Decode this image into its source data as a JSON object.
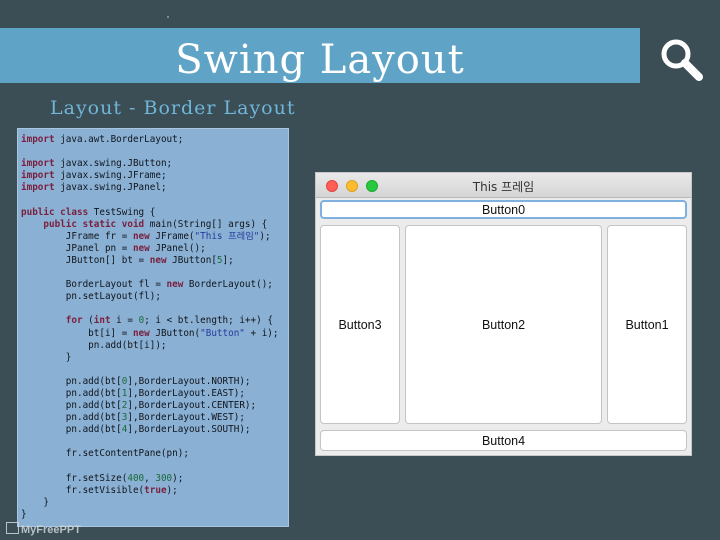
{
  "slide": {
    "title": "Swing Layout",
    "subtitle": "Layout - Border Layout",
    "watermark": "MyFreePPT",
    "colors": {
      "background": "#3b4d55",
      "title_bar": "#5fa3c6",
      "subtitle": "#6fb6d8",
      "code_panel": "#8ab0d4"
    }
  },
  "code": {
    "l01": "import",
    "l01b": " java.awt.BorderLayout;",
    "l03": "import",
    "l03b": " javax.swing.JButton;",
    "l04": "import",
    "l04b": " javax.swing.JFrame;",
    "l05": "import",
    "l05b": " javax.swing.JPanel;",
    "l07a": "public class",
    "l07b": " TestSwing {",
    "l08a": "public static void",
    "l08b": " main(String[] args) {",
    "l09a": "JFrame fr = ",
    "l09b": "new",
    "l09c": " JFrame(",
    "l09d": "\"This 프레임\"",
    "l09e": ");",
    "l10a": "JPanel pn = ",
    "l10b": "new",
    "l10c": " JPanel();",
    "l11a": "JButton[] bt = ",
    "l11b": "new",
    "l11c": " JButton[",
    "l11d": "5",
    "l11e": "];",
    "l13a": "BorderLayout fl = ",
    "l13b": "new",
    "l13c": " BorderLayout();",
    "l14": "pn.setLayout(fl);",
    "l16a": "for",
    "l16b": " (",
    "l16c": "int",
    "l16d": " i = ",
    "l16e": "0",
    "l16f": "; i < bt.length; i++) {",
    "l17a": "bt[i] = ",
    "l17b": "new",
    "l17c": " JButton(",
    "l17d": "\"Button\"",
    "l17e": " + i);",
    "l18": "pn.add(bt[i]);",
    "l19": "}",
    "l21a": "pn.add(bt[",
    "l21b": "0",
    "l21c": "],BorderLayout.NORTH);",
    "l22a": "pn.add(bt[",
    "l22b": "1",
    "l22c": "],BorderLayout.EAST);",
    "l23a": "pn.add(bt[",
    "l23b": "2",
    "l23c": "],BorderLayout.CENTER);",
    "l24a": "pn.add(bt[",
    "l24b": "3",
    "l24c": "],BorderLayout.WEST);",
    "l25a": "pn.add(bt[",
    "l25b": "4",
    "l25c": "],BorderLayout.SOUTH);",
    "l27": "fr.setContentPane(pn);",
    "l29a": "fr.setSize(",
    "l29b": "400",
    "l29c": ", ",
    "l29d": "300",
    "l29e": ");",
    "l30a": "fr.setVisible(",
    "l30b": "true",
    "l30c": ");",
    "l31": "}",
    "l32": "}"
  },
  "window": {
    "title": "This 프레임",
    "buttons": {
      "north": "Button0",
      "east": "Button1",
      "center": "Button2",
      "west": "Button3",
      "south": "Button4"
    }
  }
}
